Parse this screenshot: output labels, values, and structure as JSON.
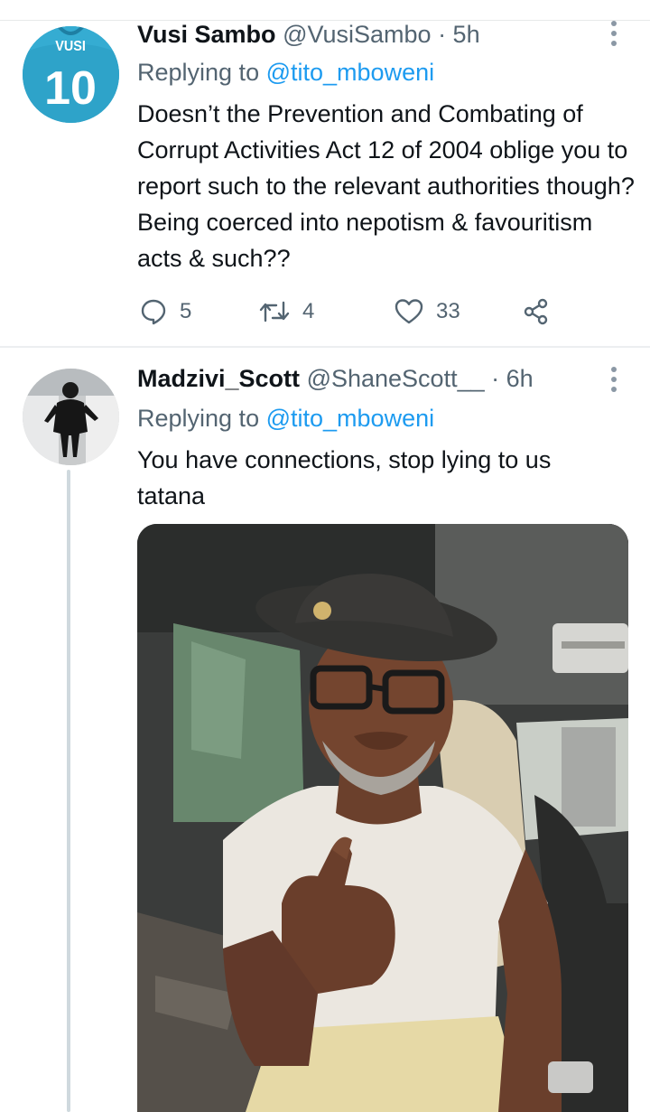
{
  "tweets": [
    {
      "display_name": "Vusi Sambo",
      "handle": "@VusiSambo",
      "time": "· 5h",
      "replying_prefix": "Replying to",
      "replying_to": "@tito_mboweni",
      "avatar_text": {
        "top": "VUSI",
        "number": "10"
      },
      "text": "Doesn’t the Prevention and Combating of Corrupt Activities Act 12 of 2004 oblige you to report such to the relevant authorities though? Being coerced into nepotism & favouritism acts & such??",
      "replies": "5",
      "retweets": "4",
      "likes": "33"
    },
    {
      "display_name": "Madzivi_Scott",
      "handle": "@ShaneScott__",
      "time": "· 6h",
      "replying_prefix": "Replying to",
      "replying_to": "@tito_mboweni",
      "text": "You have connections, stop lying to us tatana"
    }
  ],
  "icons": {
    "more": "more-vertical-icon",
    "reply": "reply-icon",
    "retweet": "retweet-icon",
    "like": "heart-icon",
    "share": "share-icon"
  },
  "colors": {
    "link": "#1d9bf0",
    "secondary_text": "#536471",
    "primary_text": "#0f1419",
    "thread_line": "#cfd9de",
    "avatar_bg": "#2d9fc4"
  }
}
